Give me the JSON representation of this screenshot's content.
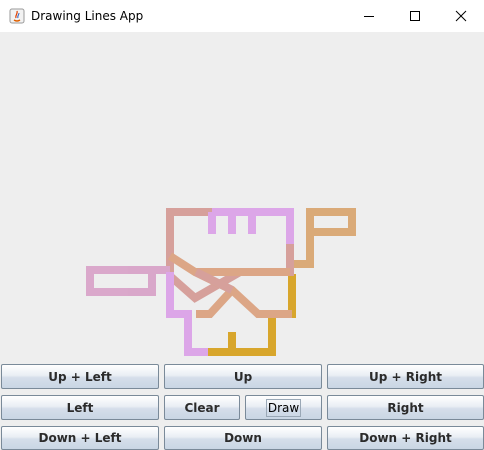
{
  "window": {
    "title": "Drawing Lines App"
  },
  "title_bar_controls": {
    "minimize_icon": "minimize-icon",
    "maximize_icon": "maximize-icon",
    "close_icon": "close-icon"
  },
  "buttons": {
    "up_left": "Up + Left",
    "up": "Up",
    "up_right": "Up + Right",
    "left": "Left",
    "clear": "Clear",
    "draw": "Draw",
    "right": "Right",
    "down_left": "Down + Left",
    "down": "Down",
    "down_right": "Down + Right"
  },
  "drawing": {
    "stroke_colors": [
      "#d49a94",
      "#d5a0d4",
      "#d9a56e",
      "#d7a01c",
      "#dba0e8"
    ]
  }
}
